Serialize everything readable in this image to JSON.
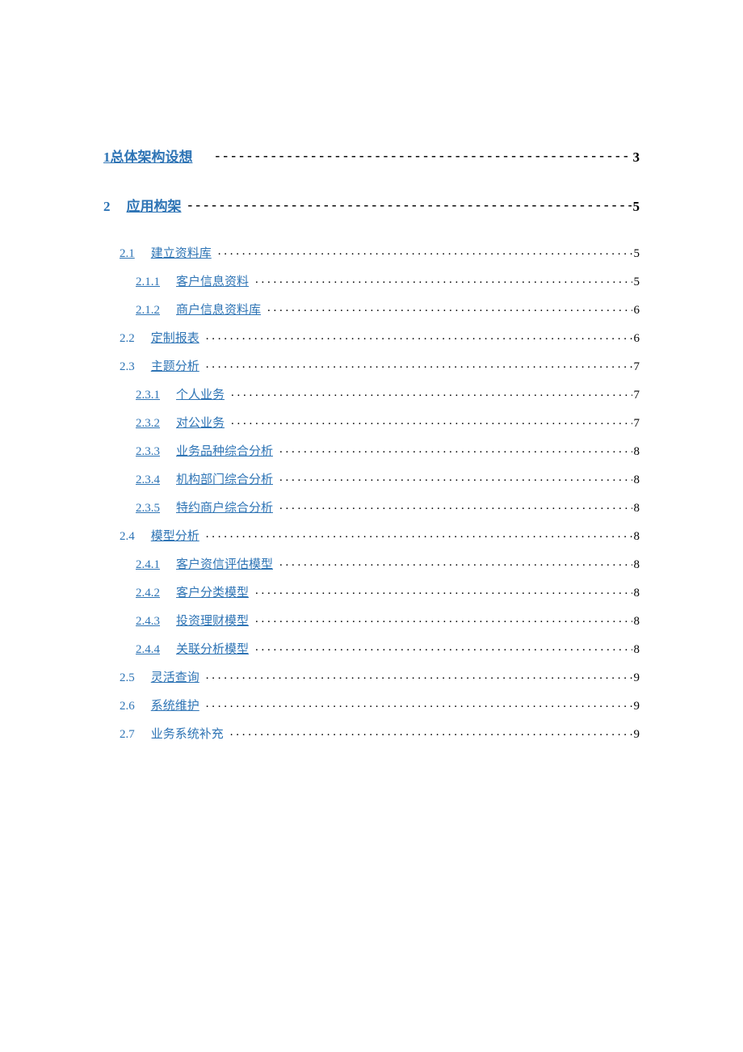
{
  "toc": [
    {
      "level": 1,
      "num": "1",
      "title": "总体架构设想",
      "page": "3",
      "leader": "dashes",
      "num_linked": true,
      "title_linked": true,
      "joined": true
    },
    {
      "level": 1,
      "num": "2",
      "title": "应用构架",
      "page": "5",
      "leader": "dashes",
      "num_linked": false,
      "title_linked": true
    },
    {
      "level": 2,
      "num": "2.1",
      "title": "建立资料库",
      "page": "5",
      "leader": "dots",
      "num_linked": true,
      "title_linked": true
    },
    {
      "level": 3,
      "num": "2.1.1",
      "title": "客户信息资料",
      "page": "5",
      "leader": "dots",
      "num_linked": true,
      "title_linked": true
    },
    {
      "level": 3,
      "num": "2.1.2",
      "title": "商户信息资料库",
      "page": "6",
      "leader": "dots",
      "num_linked": true,
      "title_linked": true
    },
    {
      "level": 2,
      "num": "2.2",
      "title": "定制报表",
      "page": "6",
      "leader": "dots",
      "num_linked": false,
      "title_linked": true
    },
    {
      "level": 2,
      "num": "2.3",
      "title": "主题分析",
      "page": "7",
      "leader": "dots",
      "num_linked": false,
      "title_linked": true
    },
    {
      "level": 3,
      "num": "2.3.1",
      "title": "个人业务",
      "page": "7",
      "leader": "dots",
      "num_linked": true,
      "title_linked": true
    },
    {
      "level": 3,
      "num": "2.3.2",
      "title": "对公业务",
      "page": "7",
      "leader": "dots",
      "num_linked": true,
      "title_linked": true
    },
    {
      "level": 3,
      "num": "2.3.3",
      "title": "业务品种综合分析",
      "page": "8",
      "leader": "dots",
      "num_linked": true,
      "title_linked": true
    },
    {
      "level": 3,
      "num": "2.3.4",
      "title": "机构部门综合分析",
      "page": "8",
      "leader": "dots",
      "num_linked": true,
      "title_linked": true
    },
    {
      "level": 3,
      "num": "2.3.5",
      "title": "特约商户综合分析",
      "page": "8",
      "leader": "dots",
      "num_linked": true,
      "title_linked": true
    },
    {
      "level": 2,
      "num": "2.4",
      "title": "模型分析",
      "page": "8",
      "leader": "dots",
      "num_linked": false,
      "title_linked": true
    },
    {
      "level": 3,
      "num": "2.4.1",
      "title": "客户资信评估模型",
      "page": "8",
      "leader": "dots",
      "num_linked": true,
      "title_linked": true
    },
    {
      "level": 3,
      "num": "2.4.2",
      "title": "客户分类模型",
      "page": "8",
      "leader": "dots",
      "num_linked": true,
      "title_linked": true
    },
    {
      "level": 3,
      "num": "2.4.3",
      "title": "投资理财模型",
      "page": "8",
      "leader": "dots",
      "num_linked": true,
      "title_linked": true
    },
    {
      "level": 3,
      "num": "2.4.4",
      "title": "关联分析模型",
      "page": "8",
      "leader": "dots",
      "num_linked": true,
      "title_linked": true
    },
    {
      "level": 2,
      "num": "2.5",
      "title": "灵活查询",
      "page": "9",
      "leader": "dots",
      "num_linked": false,
      "title_linked": true
    },
    {
      "level": 2,
      "num": "2.6",
      "title": "系统维护",
      "page": "9",
      "leader": "dots",
      "num_linked": false,
      "title_linked": true
    },
    {
      "level": 2,
      "num": "2.7",
      "title": "业务系统补充",
      "page": "9",
      "leader": "dots",
      "num_linked": false,
      "title_linked": false
    }
  ]
}
